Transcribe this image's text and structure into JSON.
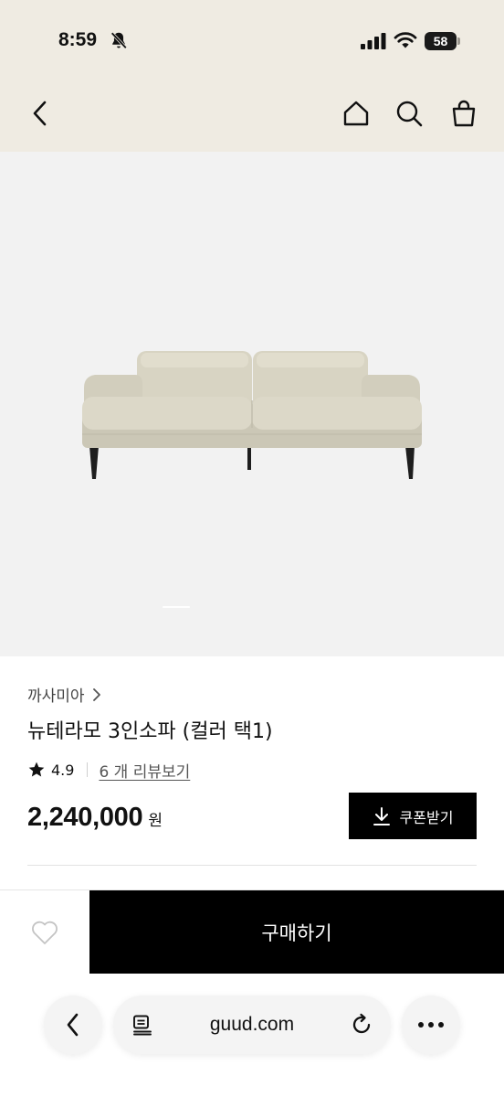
{
  "status_bar": {
    "time": "8:59",
    "battery": "58"
  },
  "header": {
    "back_icon": "chevron-left-icon",
    "icons": [
      "home-icon",
      "search-icon",
      "shopping-bag-icon"
    ]
  },
  "product": {
    "image": "sofa-image",
    "brand": "까사미아",
    "title": "뉴테라모 3인소파 (컬러 택1)",
    "rating": "4.9",
    "review_link": "6 개 리뷰보기",
    "price": "2,240,000",
    "price_unit": "원",
    "coupon_label": "쿠폰받기"
  },
  "buy_bar": {
    "purchase_label": "구매하기"
  },
  "browser": {
    "url": "guud.com"
  },
  "colors": {
    "header_bg": "#efebe2",
    "hero_bg": "#f2f2f2",
    "primary": "#000000"
  }
}
